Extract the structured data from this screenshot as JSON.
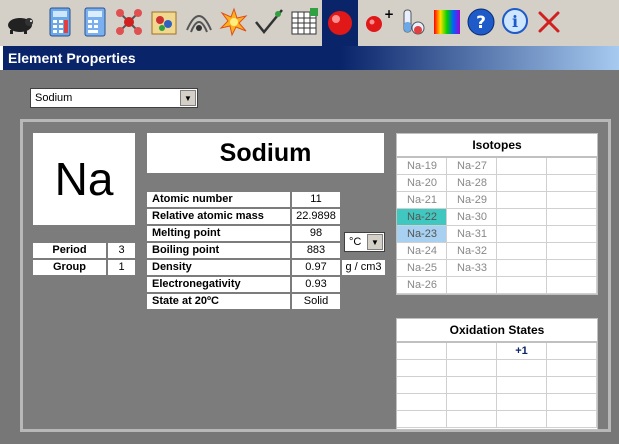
{
  "toolbar": {
    "icons": [
      "mole-icon",
      "periodic-calculator-icon",
      "calculator-icon",
      "molecule-icon",
      "atom-model-icon",
      "orbit-icon",
      "explosion-icon",
      "checkmark-graph-icon",
      "data-grid-icon",
      "element-properties-icon",
      "ion-icon",
      "test-tube-icon",
      "spectrum-icon",
      "help-icon",
      "info-icon",
      "close-icon"
    ],
    "active": "element-properties-icon"
  },
  "window": {
    "title": "Element Properties"
  },
  "element_select": {
    "value": "Sodium"
  },
  "element": {
    "symbol": "Na",
    "name": "Sodium",
    "period_label": "Period",
    "period": "3",
    "group_label": "Group",
    "group": "1"
  },
  "properties": [
    {
      "label": "Atomic number",
      "value": "11",
      "unit": ""
    },
    {
      "label": "Relative atomic mass",
      "value": "22.9898",
      "unit": ""
    },
    {
      "label": "Melting point",
      "value": "98",
      "unit": ""
    },
    {
      "label": "Boiling point",
      "value": "883",
      "unit": ""
    },
    {
      "label": "Density",
      "value": "0.97",
      "unit": "g / cm3"
    },
    {
      "label": "Electronegativity",
      "value": "0.93",
      "unit": ""
    },
    {
      "label": "State at 20ºC",
      "value": "Solid",
      "unit": ""
    }
  ],
  "temp_unit_select": {
    "value": "°C"
  },
  "isotopes": {
    "title": "Isotopes",
    "columns": [
      [
        "Na-19",
        "Na-20",
        "Na-21",
        "Na-22",
        "Na-23",
        "Na-24",
        "Na-25",
        "Na-26"
      ],
      [
        "Na-27",
        "Na-28",
        "Na-29",
        "Na-30",
        "Na-31",
        "Na-32",
        "Na-33",
        ""
      ]
    ],
    "highlights": [
      {
        "item": "Na-22",
        "color": "#40c8c0"
      },
      {
        "item": "Na-23",
        "color": "#a8d0f0"
      }
    ]
  },
  "oxidation_states": {
    "title": "Oxidation States",
    "rows": [
      [
        "",
        "",
        "+1",
        ""
      ],
      [
        "",
        "",
        "",
        ""
      ],
      [
        "",
        "",
        "",
        ""
      ],
      [
        "",
        "",
        "",
        ""
      ],
      [
        "",
        "",
        "",
        ""
      ]
    ]
  },
  "colors": {
    "titlebar": "#0a246a",
    "panel": "#7c7c7c",
    "accent": "#0a246a"
  }
}
